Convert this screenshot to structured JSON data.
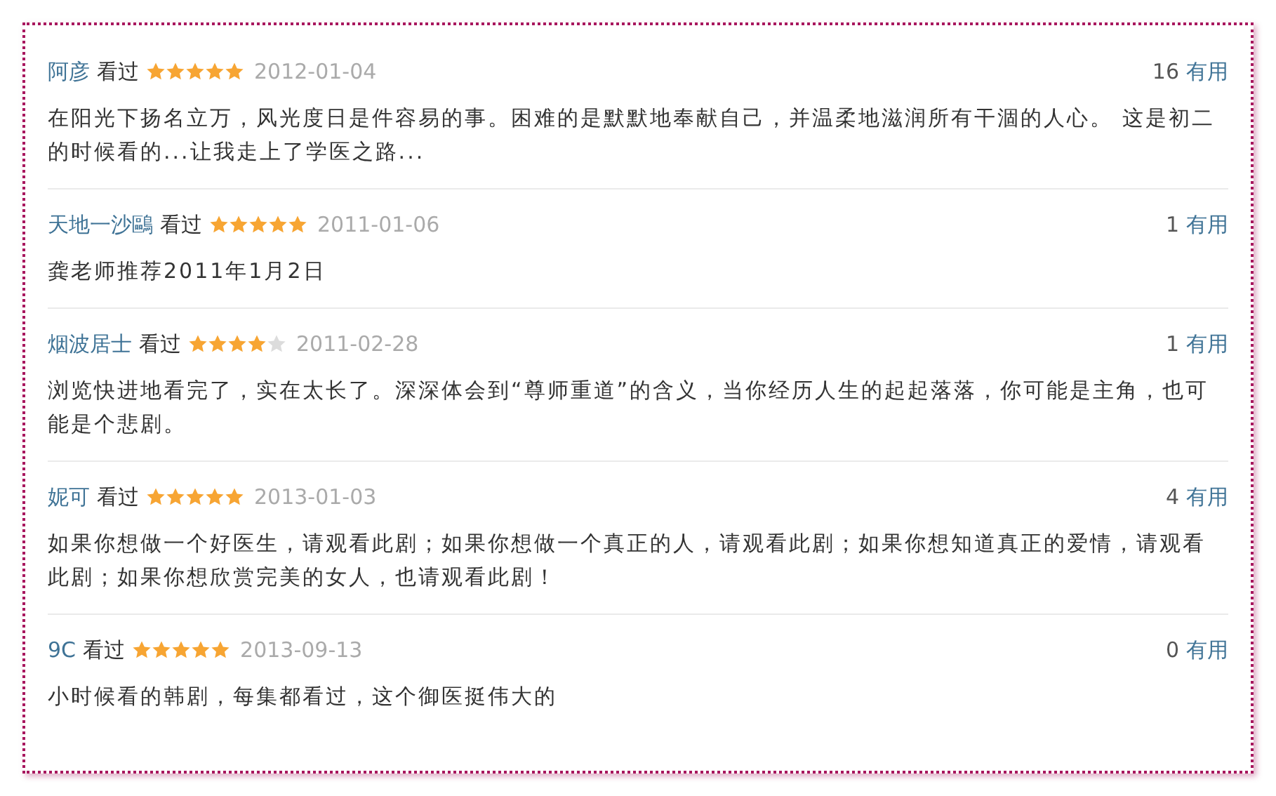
{
  "reviews": [
    {
      "user": "阿彦",
      "action": "看过",
      "stars": 5,
      "date": "2012-01-04",
      "useful_count": "16",
      "useful_label": "有用",
      "text": "在阳光下扬名立万，风光度日是件容易的事。困难的是默默地奉献自己，并温柔地滋润所有干涸的人心。 这是初二的时候看的...让我走上了学医之路..."
    },
    {
      "user": "天地一沙鷗",
      "action": "看过",
      "stars": 5,
      "date": "2011-01-06",
      "useful_count": "1",
      "useful_label": "有用",
      "text": "龚老师推荐2011年1月2日"
    },
    {
      "user": "烟波居士",
      "action": "看过",
      "stars": 4,
      "date": "2011-02-28",
      "useful_count": "1",
      "useful_label": "有用",
      "text": "浏览快进地看完了，实在太长了。深深体会到“尊师重道”的含义，当你经历人生的起起落落，你可能是主角，也可能是个悲剧。"
    },
    {
      "user": "妮可",
      "action": "看过",
      "stars": 5,
      "date": "2013-01-03",
      "useful_count": "4",
      "useful_label": "有用",
      "text": "如果你想做一个好医生，请观看此剧；如果你想做一个真正的人，请观看此剧；如果你想知道真正的爱情，请观看此剧；如果你想欣赏完美的女人，也请观看此剧！"
    },
    {
      "user": "9C",
      "action": "看过",
      "stars": 5,
      "date": "2013-09-13",
      "useful_count": "0",
      "useful_label": "有用",
      "text": "小时候看的韩剧，每集都看过，这个御医挺伟大的"
    }
  ]
}
